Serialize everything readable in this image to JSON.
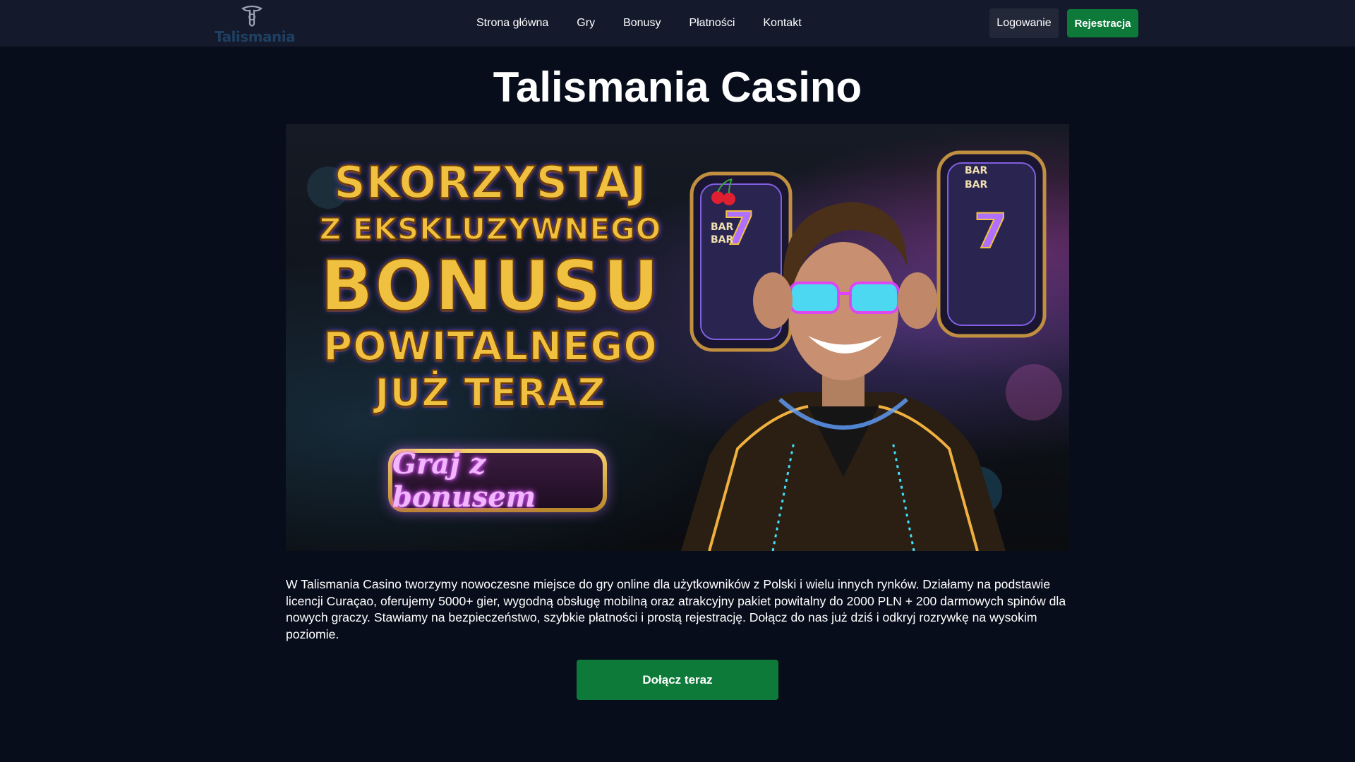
{
  "header": {
    "logo_text": "Talismania",
    "nav": [
      {
        "label": "Strona główna"
      },
      {
        "label": "Gry"
      },
      {
        "label": "Bonusy"
      },
      {
        "label": "Płatności"
      },
      {
        "label": "Kontakt"
      }
    ],
    "login_label": "Logowanie",
    "register_label": "Rejestracja"
  },
  "main": {
    "title": "Talismania Casino",
    "banner": {
      "line1": "SKORZYSTAJ",
      "line2": "Z EKSKLUZYWNEGO",
      "line3": "BONUSU",
      "line4": "POWITALNEGO",
      "line5": "JUŻ TERAZ",
      "cta_label": "Graj z bonusem",
      "reel_symbols": [
        "7",
        "BAR",
        "BAR",
        "7",
        "BAR",
        "BAR"
      ]
    },
    "description": "W Talismania Casino tworzymy nowoczesne miejsce do gry online dla użytkowników z Polski i wielu innych rynków. Działamy na podstawie licencji Curaçao, oferujemy 5000+ gier, wygodną obsługę mobilną oraz atrakcyjny pakiet powitalny do 2000 PLN + 200 darmowych spinów dla nowych graczy. Stawiamy na bezpieczeństwo, szybkie płatności i prostą rejestrację. Dołącz do nas już dziś i odkryj rozrywkę na wysokim poziomie.",
    "join_label": "Dołącz teraz"
  },
  "colors": {
    "background": "#080d1b",
    "header_bg": "#141a2c",
    "accent_green": "#0d7a3a",
    "login_bg": "#222838",
    "promo_gold": "#f0c040",
    "neon_purple": "#d040ff"
  },
  "icons": [
    "talisman-logo-icon",
    "slot-reel-icon",
    "cherry-icon"
  ]
}
